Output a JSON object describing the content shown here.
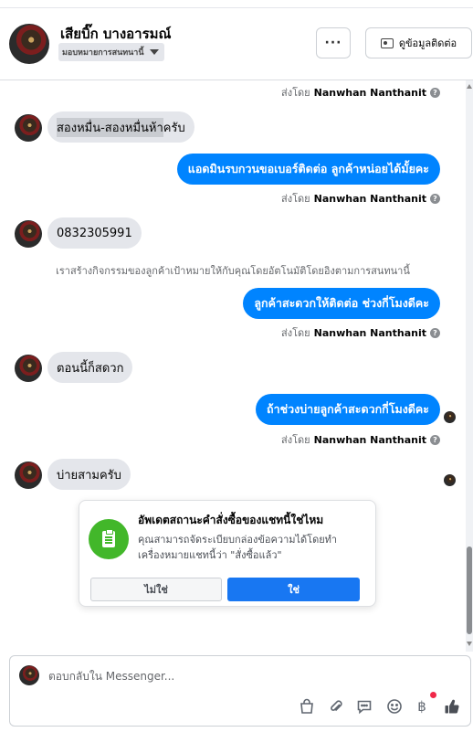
{
  "header": {
    "contact_name": "เสียบิ๊ก บางอารมณ์",
    "assign_label": "มอบหมายการสนทนานี้",
    "more_label": "···",
    "view_contact_label": "ดูข้อมูลติดต่อ"
  },
  "messages": {
    "sent_by_prefix": "ส่งโดย",
    "agent_name": "Nanwhan Nanthanit",
    "info_symbol": "?",
    "incoming_1_highlight": "สองหมื่น-สองหมื่นห้า",
    "incoming_1_rest": "ครับ",
    "outgoing_1": "แอดมินรบกวนขอเบอร์ติดต่อ ลูกค้าหน่อยได้มั้ยคะ",
    "incoming_2": "0832305991",
    "system_note": "เราสร้างกิจกรรมของลูกค้าเป้าหมายให้กับคุณโดยอัตโนมัติโดยอิงตามการสนทนานี้",
    "outgoing_2": "ลูกค้าสะดวกให้ติดต่อ ช่วงกี่โมงดีคะ",
    "incoming_3": "ตอนนี้ก็สดวก",
    "outgoing_3": "ถ้าช่วงบ่ายลูกค้าสะดวกกี่โมงดีคะ",
    "incoming_4": "บ่ายสามครับ"
  },
  "order_card": {
    "title": "อัพเดตสถานะคำสั่งซื้อของแชทนี้ใช่ไหม",
    "description": "คุณสามารถจัดระเบียบกล่องข้อความได้โดยทำเครื่องหมายแชทนี้ว่า \"สั่งซื้อแล้ว\"",
    "no_label": "ไม่ใช่",
    "yes_label": "ใช่"
  },
  "composer": {
    "placeholder": "ตอบกลับใน Messenger...",
    "currency_symbol": "฿"
  },
  "colors": {
    "accent": "#0084ff",
    "confirm": "#1877f2",
    "badge": "#42b72a",
    "notification": "#f02849"
  },
  "icons": [
    "more-icon",
    "contact-card-icon",
    "info-icon",
    "clipboard-icon",
    "shopping-bag-icon",
    "attachment-icon",
    "saved-reply-icon",
    "emoji-icon",
    "currency-icon",
    "thumbs-up-icon"
  ]
}
